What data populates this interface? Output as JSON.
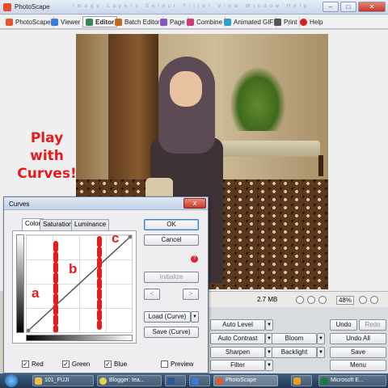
{
  "app": {
    "title": "PhotoScape",
    "faint_menu": "Image Layers Select Filter View Window Help"
  },
  "tabs": [
    {
      "label": "PhotoScape",
      "color": "#e5582e"
    },
    {
      "label": "Viewer",
      "color": "#3a7bd5"
    },
    {
      "label": "Editor",
      "color": "#2e8b57"
    },
    {
      "label": "Batch Editor",
      "color": "#c46a1d"
    },
    {
      "label": "Page",
      "color": "#8a56c2"
    },
    {
      "label": "Combine",
      "color": "#d23b7a"
    },
    {
      "label": "Animated GIF",
      "color": "#2f9fc4"
    },
    {
      "label": "Print",
      "color": "#555555"
    },
    {
      "label": "Help",
      "color": "#d22222"
    }
  ],
  "overlay_text": [
    "Play",
    "with",
    "Curves!"
  ],
  "curve_labels": {
    "a": "a",
    "b": "b",
    "c": "c"
  },
  "status": {
    "file_size": "2.7 MB",
    "zoom": "48%"
  },
  "panel": {
    "auto_level": "Auto Level",
    "auto_contrast": "Auto Contrast",
    "sharpen": "Sharpen",
    "filter": "Filter",
    "bloom": "Bloom",
    "backlight": "Backlight",
    "undo": "Undo",
    "redo": "Redo",
    "undo_all": "Undo All",
    "save": "Save",
    "menu": "Menu"
  },
  "dialog": {
    "title": "Curves",
    "close": "x",
    "tabs": [
      "Color",
      "Saturation",
      "Luminance"
    ],
    "ok": "OK",
    "cancel": "Cancel",
    "initialize": "Initialize",
    "prev": "<",
    "next": ">",
    "load_curve": "Load (Curve)",
    "save_curve": "Save (Curve)",
    "checkboxes": {
      "red": "Red",
      "green": "Green",
      "blue": "Blue",
      "preview": "Preview"
    }
  },
  "taskbar": [
    {
      "label": "101_FUJI",
      "color": "#e8c04a"
    },
    {
      "label": "Blogger: tea...",
      "color": "#e8d44a"
    },
    {
      "label": "",
      "color": "#2b579a"
    },
    {
      "label": "",
      "color": "#3a7bd5"
    },
    {
      "label": "PhotoScape",
      "color": "#e5582e"
    },
    {
      "label": "",
      "color": "#e8a020"
    },
    {
      "label": "Microsoft E...",
      "color": "#1d7a3e"
    }
  ]
}
